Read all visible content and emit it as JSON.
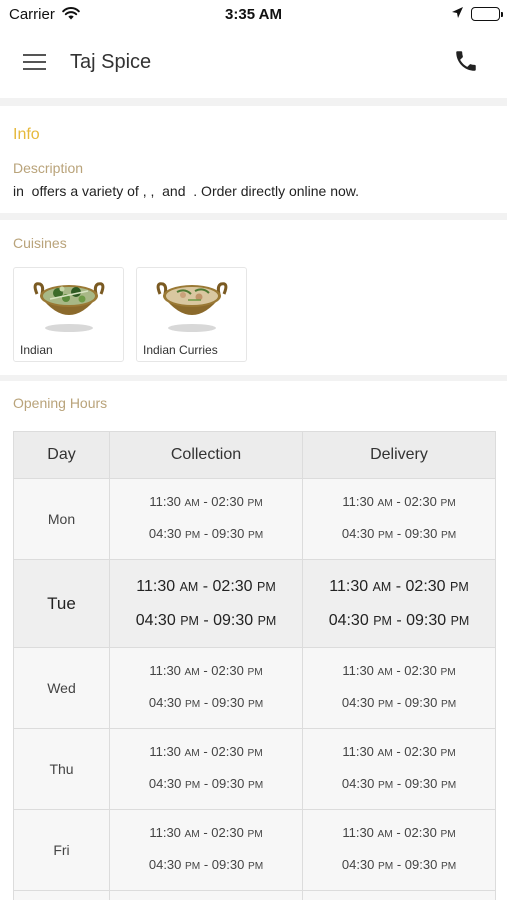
{
  "status_bar": {
    "carrier": "Carrier",
    "time": "3:35 AM"
  },
  "header": {
    "title": "Taj Spice",
    "menu_icon": "hamburger-menu-icon",
    "phone_icon": "phone-icon"
  },
  "info": {
    "title": "Info",
    "description_label": "Description",
    "description_text": "in  offers a variety of , ,  and  . Order directly online now."
  },
  "cuisines": {
    "label": "Cuisines",
    "items": [
      {
        "name": "Indian",
        "image": "green-curry-bowl"
      },
      {
        "name": "Indian Curries",
        "image": "cream-curry-bowl"
      }
    ]
  },
  "opening_hours": {
    "label": "Opening Hours",
    "columns": [
      "Day",
      "Collection",
      "Delivery"
    ],
    "today": "Tue",
    "rows": [
      {
        "day": "Mon",
        "collection": [
          [
            "11:30",
            "AM",
            "02:30",
            "PM"
          ],
          [
            "04:30",
            "PM",
            "09:30",
            "PM"
          ]
        ],
        "delivery": [
          [
            "11:30",
            "AM",
            "02:30",
            "PM"
          ],
          [
            "04:30",
            "PM",
            "09:30",
            "PM"
          ]
        ]
      },
      {
        "day": "Tue",
        "collection": [
          [
            "11:30",
            "AM",
            "02:30",
            "PM"
          ],
          [
            "04:30",
            "PM",
            "09:30",
            "PM"
          ]
        ],
        "delivery": [
          [
            "11:30",
            "AM",
            "02:30",
            "PM"
          ],
          [
            "04:30",
            "PM",
            "09:30",
            "PM"
          ]
        ]
      },
      {
        "day": "Wed",
        "collection": [
          [
            "11:30",
            "AM",
            "02:30",
            "PM"
          ],
          [
            "04:30",
            "PM",
            "09:30",
            "PM"
          ]
        ],
        "delivery": [
          [
            "11:30",
            "AM",
            "02:30",
            "PM"
          ],
          [
            "04:30",
            "PM",
            "09:30",
            "PM"
          ]
        ]
      },
      {
        "day": "Thu",
        "collection": [
          [
            "11:30",
            "AM",
            "02:30",
            "PM"
          ],
          [
            "04:30",
            "PM",
            "09:30",
            "PM"
          ]
        ],
        "delivery": [
          [
            "11:30",
            "AM",
            "02:30",
            "PM"
          ],
          [
            "04:30",
            "PM",
            "09:30",
            "PM"
          ]
        ]
      },
      {
        "day": "Fri",
        "collection": [
          [
            "11:30",
            "AM",
            "02:30",
            "PM"
          ],
          [
            "04:30",
            "PM",
            "09:30",
            "PM"
          ]
        ],
        "delivery": [
          [
            "11:30",
            "AM",
            "02:30",
            "PM"
          ],
          [
            "04:30",
            "PM",
            "09:30",
            "PM"
          ]
        ]
      }
    ]
  },
  "colors": {
    "accent_gold": "#e6b93c",
    "label_tan": "#b9a37a"
  }
}
